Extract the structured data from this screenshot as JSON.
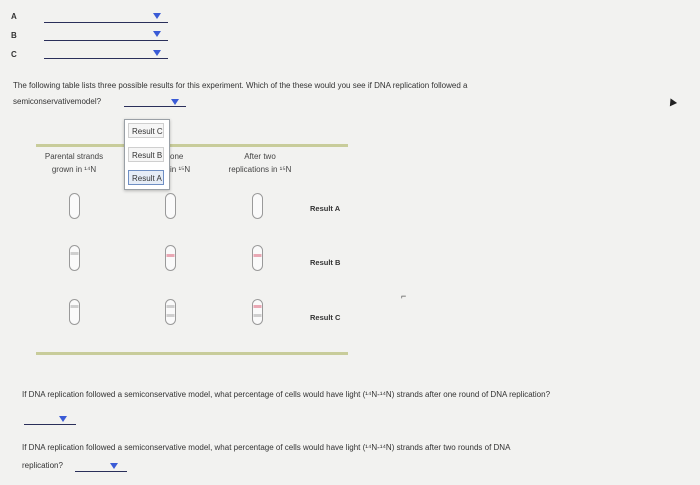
{
  "matching": [
    {
      "letter": "A"
    },
    {
      "letter": "B"
    },
    {
      "letter": "C"
    }
  ],
  "question1": {
    "text": "The following table lists three possible results for this experiment. Which of the these would you see if DNA replication followed a",
    "text2": "semiconservativemodel?"
  },
  "dropdown_options": [
    "Result C",
    "Result B",
    "Result A"
  ],
  "table": {
    "header_col1_line1": "Parental strands",
    "header_col1_line2": "grown in ¹⁴N",
    "header_col2_partial_a": "one",
    "header_col2_partial_b": "in ¹⁵N",
    "header_col3_line1": "After two",
    "header_col3_line2": "replications in ¹⁵N",
    "rows": [
      {
        "label": "Result A"
      },
      {
        "label": "Result B"
      },
      {
        "label": "Result C"
      }
    ]
  },
  "question2": {
    "text": "If DNA replication followed a semiconservative model, what percentage of cells would have light (¹⁴N-¹⁴N) strands after one round of DNA replication?"
  },
  "question3": {
    "text": "If DNA replication followed a semiconservative model, what percentage of cells would have light (¹⁴N-¹⁴N) strands after two rounds of DNA",
    "text2": "replication?"
  },
  "colors": {
    "caret": "#3a5bd6",
    "band_pink": "#e9a8b4",
    "table_rule": "#c8cc9a"
  },
  "icons": [
    "caret-down-icon",
    "test-tube-icon",
    "mouse-cursor-icon"
  ]
}
